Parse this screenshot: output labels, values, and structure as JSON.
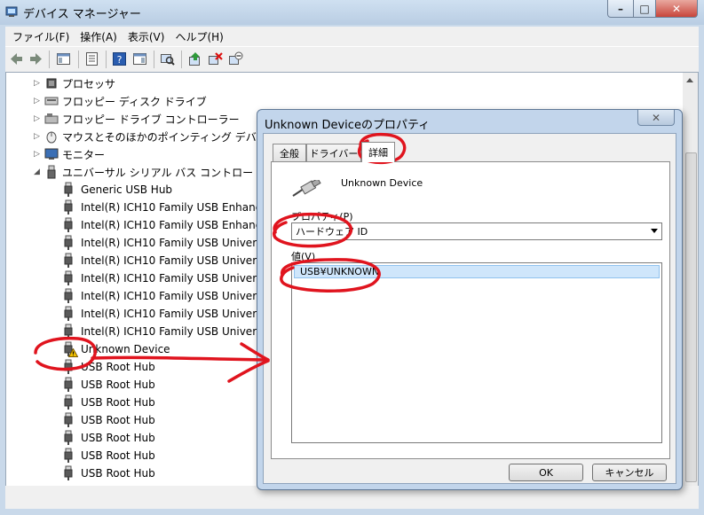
{
  "window": {
    "title": "デバイス マネージャー",
    "min_glyph": "–",
    "max_glyph": "□",
    "close_glyph": "✕"
  },
  "menu": [
    "ファイル(F)",
    "操作(A)",
    "表示(V)",
    "ヘルプ(H)"
  ],
  "toolbar_icons": [
    "back-icon",
    "forward-icon",
    "show-hide-console-tree-icon",
    "properties-icon",
    "help-icon",
    "action-pane-icon",
    "scan-hardware-icon",
    "update-driver-icon",
    "uninstall-icon",
    "disable-icon"
  ],
  "tree": {
    "categories": [
      {
        "label": "プロセッサ",
        "icon": "processor-icon"
      },
      {
        "label": "フロッピー ディスク ドライブ",
        "icon": "floppy-disk-icon"
      },
      {
        "label": "フロッピー ドライブ コントローラー",
        "icon": "floppy-controller-icon"
      },
      {
        "label": "マウスとそのほかのポインティング デバ",
        "icon": "mouse-icon"
      },
      {
        "label": "モニター",
        "icon": "monitor-icon"
      },
      {
        "label": "ユニバーサル シリアル バス コントロー",
        "icon": "usb-icon"
      }
    ],
    "usb_children": [
      "Generic USB Hub",
      "Intel(R) ICH10 Family USB Enhanc",
      "Intel(R) ICH10 Family USB Enhanc",
      "Intel(R) ICH10 Family USB Univer",
      "Intel(R) ICH10 Family USB Univer",
      "Intel(R) ICH10 Family USB Univer",
      "Intel(R) ICH10 Family USB Univer",
      "Intel(R) ICH10 Family USB Univer",
      "Intel(R) ICH10 Family USB Univer",
      "Unknown Device",
      "USB Root Hub",
      "USB Root Hub",
      "USB Root Hub",
      "USB Root Hub",
      "USB Root Hub",
      "USB Root Hub",
      "USB Root Hub"
    ]
  },
  "dialog": {
    "title": "Unknown Deviceのプロパティ",
    "close_glyph": "✕",
    "tabs": [
      "全般",
      "ドライバー",
      "詳細"
    ],
    "active_tab": "詳細",
    "device_name": "Unknown Device",
    "property_label": "プロパティ(P)",
    "property_value": "ハードウェア ID",
    "value_label": "値(V)",
    "value_item": "USB¥UNKNOWN",
    "ok_label": "OK",
    "cancel_label": "キャンセル"
  },
  "colors": {
    "annotation_red": "#e0141e",
    "warning_yellow": "#f5c400",
    "selection_blue": "#cfe6fb"
  }
}
